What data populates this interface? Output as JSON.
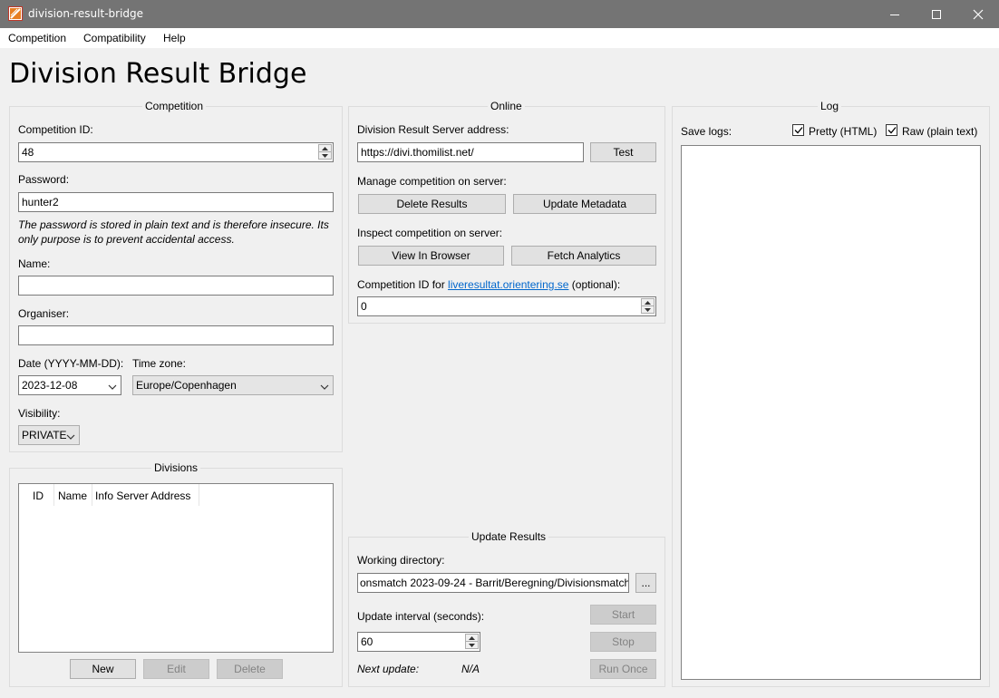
{
  "window": {
    "title": "division-result-bridge"
  },
  "menu": [
    "Competition",
    "Compatibility",
    "Help"
  ],
  "app_title": "Division Result Bridge",
  "competition": {
    "group_title": "Competition",
    "id_label": "Competition ID:",
    "id_value": "48",
    "password_label": "Password:",
    "password_value": "hunter2",
    "password_note": "The password is stored in plain text and is therefore insecure. Its only purpose is to prevent accidental access.",
    "name_label": "Name:",
    "name_value": "",
    "organiser_label": "Organiser:",
    "organiser_value": "",
    "date_label": "Date (YYYY-MM-DD):",
    "date_value": "2023-12-08",
    "timezone_label": "Time zone:",
    "timezone_value": "Europe/Copenhagen",
    "visibility_label": "Visibility:",
    "visibility_value": "PRIVATE"
  },
  "divisions": {
    "group_title": "Divisions",
    "columns": [
      "ID",
      "Name",
      "Info Server Address"
    ],
    "rows": [],
    "new_label": "New",
    "edit_label": "Edit",
    "delete_label": "Delete"
  },
  "online": {
    "group_title": "Online",
    "server_label": "Division Result Server address:",
    "server_value": "https://divi.thomilist.net/",
    "test_label": "Test",
    "manage_label": "Manage competition on server:",
    "delete_results_label": "Delete Results",
    "update_metadata_label": "Update Metadata",
    "inspect_label": "Inspect competition on server:",
    "view_browser_label": "View In Browser",
    "fetch_analytics_label": "Fetch Analytics",
    "liveresultat_prefix": "Competition ID for ",
    "liveresultat_link": "liveresultat.orientering.se",
    "liveresultat_suffix": " (optional):",
    "liveresultat_value": "0"
  },
  "update": {
    "group_title": "Update Results",
    "workdir_label": "Working directory:",
    "workdir_value": "onsmatch 2023-09-24 - Barrit/Beregning/Divisionsmatch",
    "browse_label": "...",
    "interval_label": "Update interval (seconds):",
    "interval_value": "60",
    "start_label": "Start",
    "stop_label": "Stop",
    "run_once_label": "Run Once",
    "next_update_label": "Next update:",
    "next_update_value": "N/A"
  },
  "log": {
    "group_title": "Log",
    "save_logs_label": "Save logs:",
    "pretty_label": "Pretty (HTML)",
    "pretty_checked": true,
    "raw_label": "Raw (plain text)",
    "raw_checked": true
  }
}
